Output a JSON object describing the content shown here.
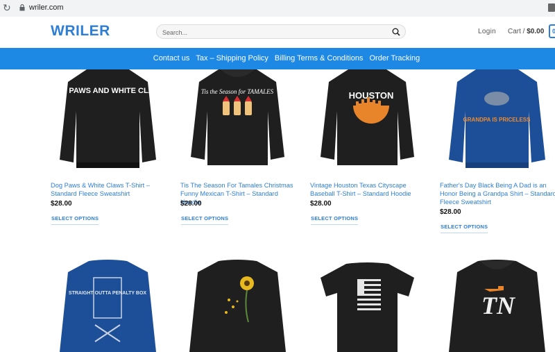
{
  "browser": {
    "url": "wriler.com"
  },
  "header": {
    "logo": "WRILER",
    "search_placeholder": "Search...",
    "login_label": "Login",
    "cart_prefix": "Cart /",
    "cart_total": "$0.00",
    "cart_count": "0"
  },
  "nav": {
    "items": [
      "Contact us",
      "Tax – Shipping Policy",
      "Billing Terms & Conditions",
      "Order Tracking"
    ]
  },
  "products": [
    {
      "title": "Dog Paws & White Claws T-Shirt – Standard Fleece Sweatshirt",
      "price": "$28.00",
      "button": "SELECT OPTIONS",
      "print": "DOG PAWS AND WHITE CLAWS"
    },
    {
      "title": "Tis The Season For Tamales Christmas Funny Mexican T-Shirt – Standard Hoodie",
      "price": "$28.00",
      "button": "SELECT OPTIONS",
      "print": "Tis the Season for TAMALES"
    },
    {
      "title": "Vintage Houston Texas Cityscape Baseball T-Shirt – Standard Hoodie",
      "price": "$28.00",
      "button": "SELECT OPTIONS",
      "print": "HOUSTON"
    },
    {
      "title": "Father's Day Black Being A Dad is an Honor Being a Grandpa Shirt – Standard Fleece Sweatshirt",
      "price": "$28.00",
      "button": "SELECT OPTIONS",
      "print": "GRANDPA IS PRICELESS"
    },
    {
      "print": "STRAIGHT OUTTA PENALTY BOX"
    },
    {
      "print": ""
    },
    {
      "print": ""
    },
    {
      "print": "TN"
    }
  ],
  "colors": {
    "accent": "#1e88e5",
    "link": "#2e7ed6",
    "garment_black": "#1f1f1f",
    "garment_blue": "#1d4f98"
  }
}
